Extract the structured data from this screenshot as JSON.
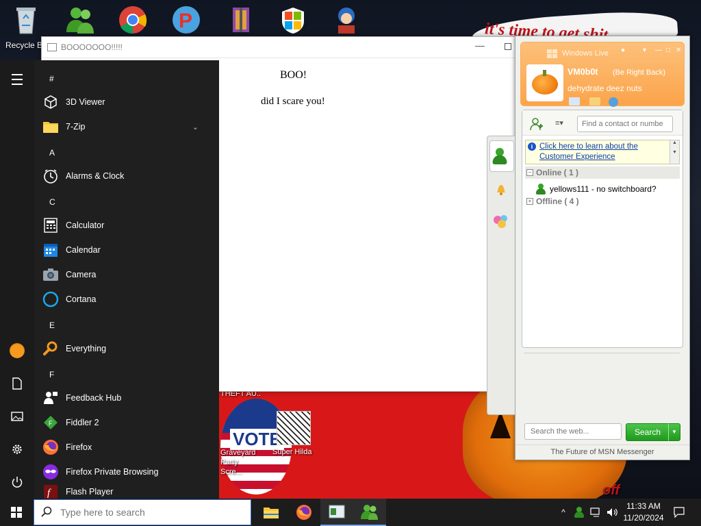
{
  "desktop": {
    "recycle_bin_label": "Recycle B",
    "banner_text": "it's time to get shit",
    "theft_label": "THEFT AU..",
    "graveyard_label": "Graveyard Party Scre...",
    "hilda_label": "Super Hilda",
    "pumpkin_text": "off"
  },
  "boo_window": {
    "title": "BOOOOOOO!!!!!",
    "heading": "BOO!",
    "body": "did I scare you!"
  },
  "start_menu": {
    "letters": [
      "#",
      "A",
      "C",
      "E",
      "F"
    ],
    "apps": [
      {
        "label": "3D Viewer",
        "icon": "cube-icon"
      },
      {
        "label": "7-Zip",
        "icon": "folder-icon"
      },
      {
        "label": "Alarms & Clock",
        "icon": "clock-icon"
      },
      {
        "label": "Calculator",
        "icon": "calculator-icon"
      },
      {
        "label": "Calendar",
        "icon": "calendar-icon"
      },
      {
        "label": "Camera",
        "icon": "camera-icon"
      },
      {
        "label": "Cortana",
        "icon": "cortana-icon"
      },
      {
        "label": "Everything",
        "icon": "magnifier-icon"
      },
      {
        "label": "Feedback Hub",
        "icon": "feedback-icon"
      },
      {
        "label": "Fiddler 2",
        "icon": "fiddler-icon"
      },
      {
        "label": "Firefox",
        "icon": "firefox-icon"
      },
      {
        "label": "Firefox Private Browsing",
        "icon": "private-browsing-icon"
      },
      {
        "label": "Flash Player",
        "icon": "flash-icon"
      }
    ]
  },
  "msn": {
    "brand": "Windows Live",
    "user_name": "VM0b0t",
    "status": "(Be Right Back)",
    "personal_message": "dehydrate deez nuts",
    "find_placeholder": "Find a contact or numbe",
    "info_link": "Click here to learn about the Customer Experience",
    "groups": {
      "online": "Online ( 1 )",
      "offline": "Offline ( 4 )"
    },
    "contact": "yellows111 - no switchboard?",
    "web_search_placeholder": "Search the web...",
    "search_button": "Search",
    "footer": "The Future of MSN Messenger"
  },
  "taskbar": {
    "search_placeholder": "Type here to search",
    "time": "11:33 AM",
    "date": "11/20/2024"
  },
  "colors": {
    "msn_orange": "#fba44a",
    "start_bg": "#1f1f1f",
    "search_green": "#1f9a1d"
  }
}
